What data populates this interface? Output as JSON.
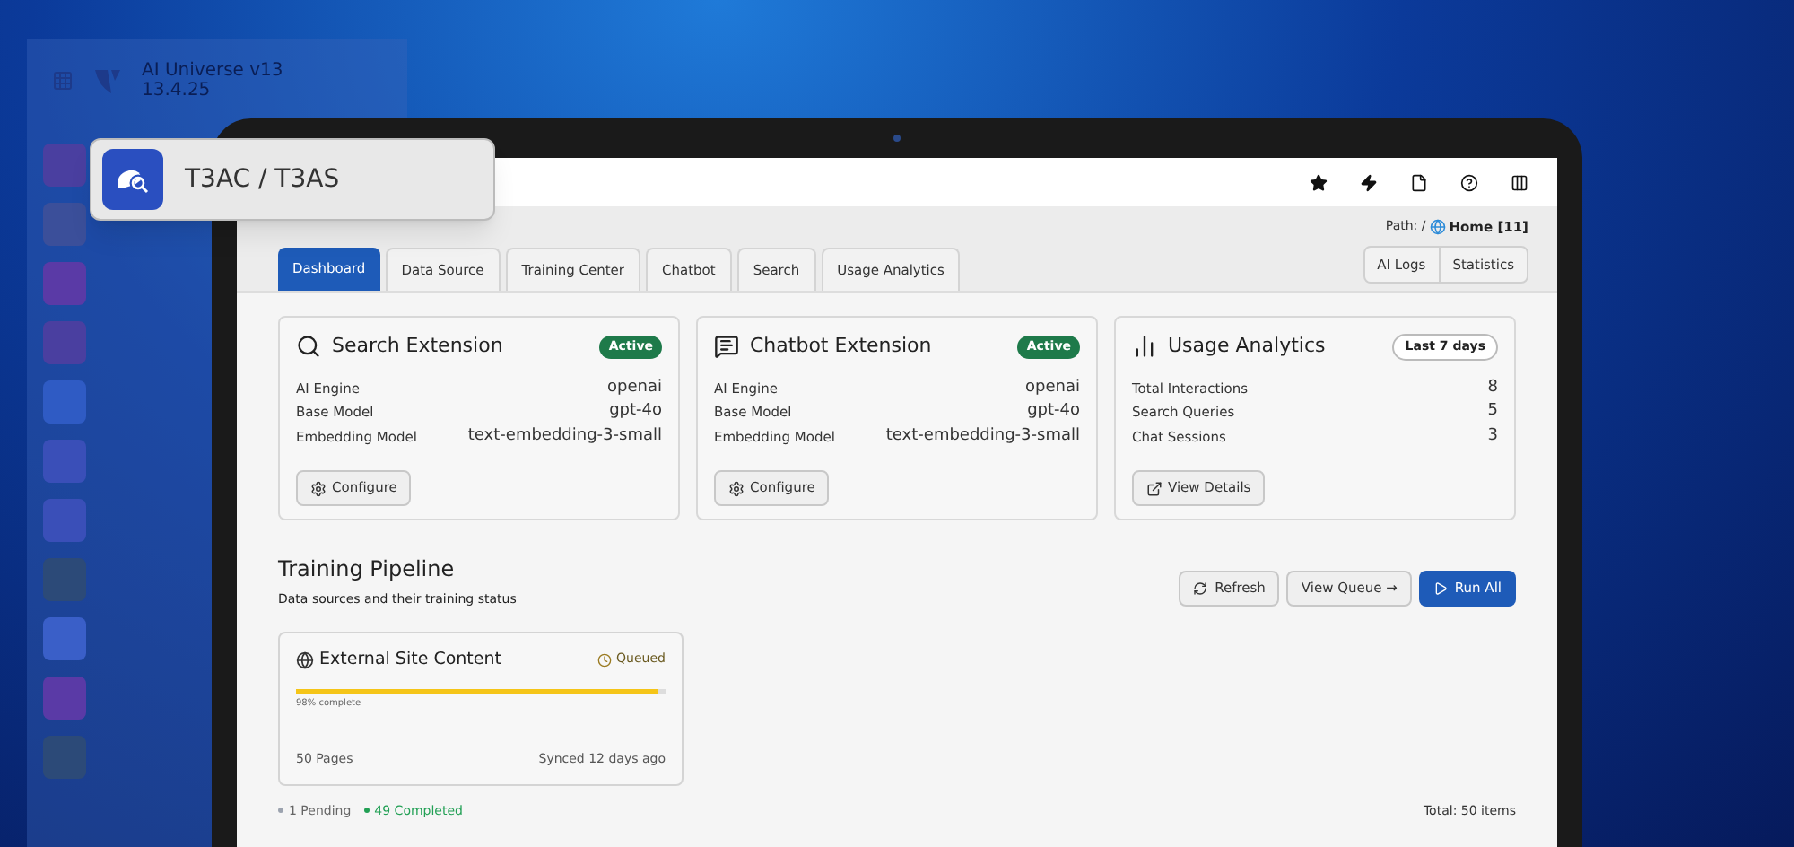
{
  "backdrop_sidebar": {
    "title": "AI Universe v13",
    "version": "13.4.25"
  },
  "module_badge": {
    "label": "T3AC / T3AS"
  },
  "toolbar": {
    "icons": [
      {
        "kind": "star"
      },
      {
        "kind": "bolt"
      },
      {
        "kind": "file"
      },
      {
        "kind": "help"
      },
      {
        "kind": "columns"
      }
    ]
  },
  "path": {
    "prefix": "Path: /",
    "page": "Home [11]"
  },
  "tabs": [
    {
      "label": "Dashboard",
      "selected": true
    },
    {
      "label": "Data Source",
      "selected": false
    },
    {
      "label": "Training Center",
      "selected": false
    },
    {
      "label": "Chatbot",
      "selected": false
    },
    {
      "label": "Search",
      "selected": false
    },
    {
      "label": "Usage Analytics",
      "selected": false
    }
  ],
  "header_buttons": [
    "AI Logs",
    "Statistics"
  ],
  "cards": [
    {
      "kind": "search",
      "title": "Search Extension",
      "badge": {
        "label": "Active",
        "kind": "active"
      },
      "rows": [
        {
          "label": "AI Engine",
          "value": "openai"
        },
        {
          "label": "Base Model",
          "value": "gpt-4o"
        },
        {
          "label": "Embedding Model",
          "value": "text-embedding-3-small"
        }
      ],
      "button": {
        "label": "Configure",
        "kind": "gear"
      }
    },
    {
      "kind": "chat",
      "title": "Chatbot Extension",
      "badge": {
        "label": "Active",
        "kind": "active"
      },
      "rows": [
        {
          "label": "AI Engine",
          "value": "openai"
        },
        {
          "label": "Base Model",
          "value": "gpt-4o"
        },
        {
          "label": "Embedding Model",
          "value": "text-embedding-3-small"
        }
      ],
      "button": {
        "label": "Configure",
        "kind": "gear"
      }
    },
    {
      "kind": "chart",
      "title": "Usage Analytics",
      "badge": {
        "label": "Last 7 days",
        "kind": "outline"
      },
      "rows": [
        {
          "label": "Total Interactions",
          "value": "8"
        },
        {
          "label": "Search Queries",
          "value": "5"
        },
        {
          "label": "Chat Sessions",
          "value": "3"
        }
      ],
      "button": {
        "label": "View Details",
        "kind": "external"
      }
    }
  ],
  "pipeline": {
    "title": "Training Pipeline",
    "subtitle": "Data sources and their training status",
    "actions": [
      {
        "label": "Refresh",
        "kind": "refresh",
        "primary": false
      },
      {
        "label": "View Queue →",
        "kind": "plain",
        "primary": false
      },
      {
        "label": "Run All",
        "kind": "play",
        "primary": true
      }
    ],
    "sources": [
      {
        "title": "External Site Content",
        "status": "Queued",
        "level": 0.98,
        "progress_text": "98% complete",
        "pages": "50 Pages",
        "synced": "Synced 12 days ago"
      }
    ],
    "summary": [
      {
        "label": "1 Pending",
        "color": "#9ca3af"
      },
      {
        "label": "49 Completed",
        "color": "#22a055"
      }
    ],
    "total": "Total: 50 items"
  }
}
